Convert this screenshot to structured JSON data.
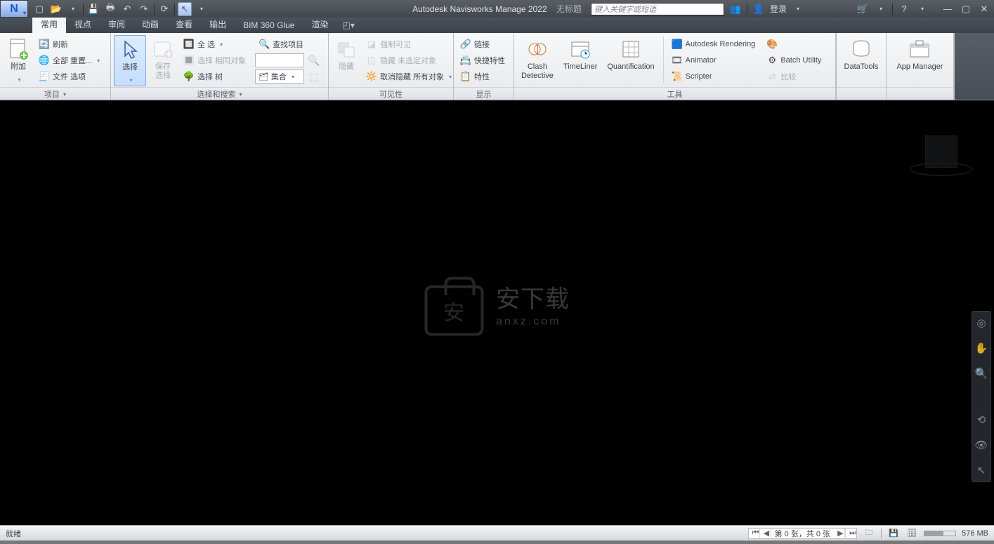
{
  "titlebar": {
    "app_title": "Autodesk Navisworks Manage 2022",
    "doc_title": "无标题",
    "search_placeholder": "键入关键字或短语",
    "login": "登录"
  },
  "qat": {
    "new": "新建",
    "open": "打开",
    "save": "保存",
    "print": "打印",
    "undo": "撤销",
    "redo": "重做",
    "refresh": "刷新",
    "select": "选择"
  },
  "tabs": {
    "home": "常用",
    "viewpoint": "视点",
    "review": "审阅",
    "animation": "动画",
    "view": "查看",
    "output": "输出",
    "bim360": "BIM 360 Glue",
    "render": "渲染"
  },
  "ribbon": {
    "project": {
      "title": "项目",
      "append": "附加",
      "refresh": "刷新",
      "reset_all": "全部 重置...",
      "file_options": "文件 选项"
    },
    "select_search": {
      "title": "选择和搜索",
      "select": "选择",
      "save_selection": "保存\n选择",
      "select_all": "全 选",
      "select_same": "选择 相同对象",
      "selection_tree": "选择 树",
      "find_items": "查找项目",
      "quick_find_placeholder": "",
      "sets": "集合"
    },
    "visibility": {
      "title": "可见性",
      "hide": "隐藏",
      "require": "强制可见",
      "hide_unselected": "隐藏 未选定对象",
      "unhide_all": "取消隐藏 所有对象"
    },
    "display": {
      "title": "显示",
      "links": "链接",
      "quick_props": "快捷特性",
      "properties": "特性"
    },
    "tools": {
      "title": "工具",
      "clash": "Clash\nDetective",
      "timeliner": "TimeLiner",
      "quantification": "Quantification",
      "autodesk_rendering": "Autodesk Rendering",
      "animator": "Animator",
      "scripter": "Scripter",
      "appearance_profiler_icon": "外观",
      "batch_utility": "Batch Utility",
      "compare": "比较",
      "datatools": "DataTools",
      "app_manager": "App Manager"
    }
  },
  "statusbar": {
    "ready": "就绪",
    "page_info": "第 0 张，共 0 张",
    "memory": "576 MB"
  },
  "watermark": {
    "line1": "安下载",
    "line2": "anxz.com"
  }
}
